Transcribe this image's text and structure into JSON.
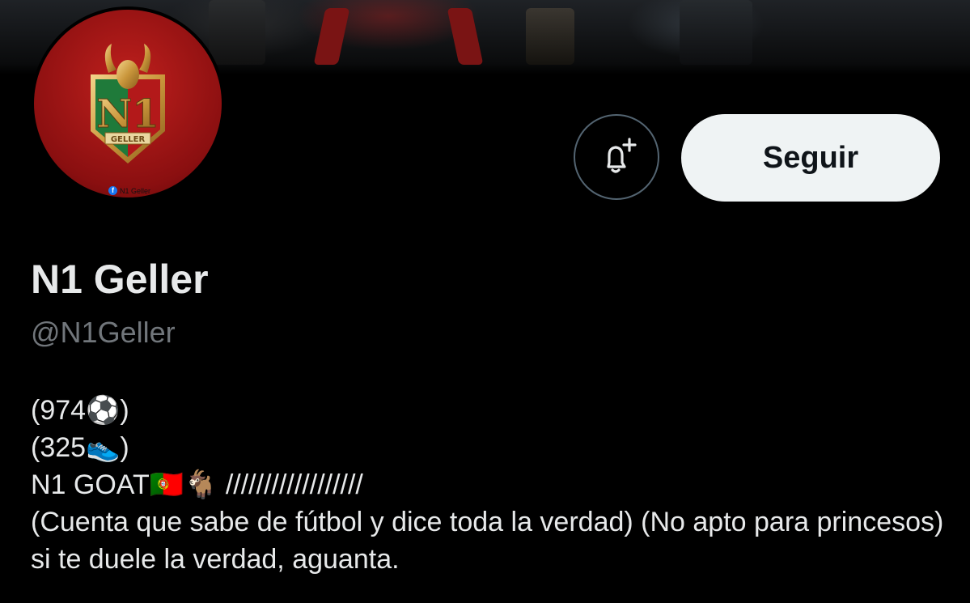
{
  "avatar": {
    "facebook_tag": "N1 Geller",
    "crest_text": "GELLER",
    "crest_letters": "N1"
  },
  "actions": {
    "notify_icon": "bell-plus-icon",
    "follow_label": "Seguir"
  },
  "profile": {
    "display_name": "N1 Geller",
    "handle": "@N1Geller"
  },
  "bio": {
    "line1": "(974⚽)",
    "line2": "(325👟)",
    "line3": "N1 GOAT🇵🇹🐐 //////////////////",
    "line4": "(Cuenta que sabe de fútbol y dice toda la verdad) (No apto para princesos) si te duele la verdad, aguanta."
  },
  "colors": {
    "background": "#000000",
    "button_bg": "#eff3f4",
    "secondary_text": "#71767b",
    "avatar_red": "#c0201d"
  }
}
